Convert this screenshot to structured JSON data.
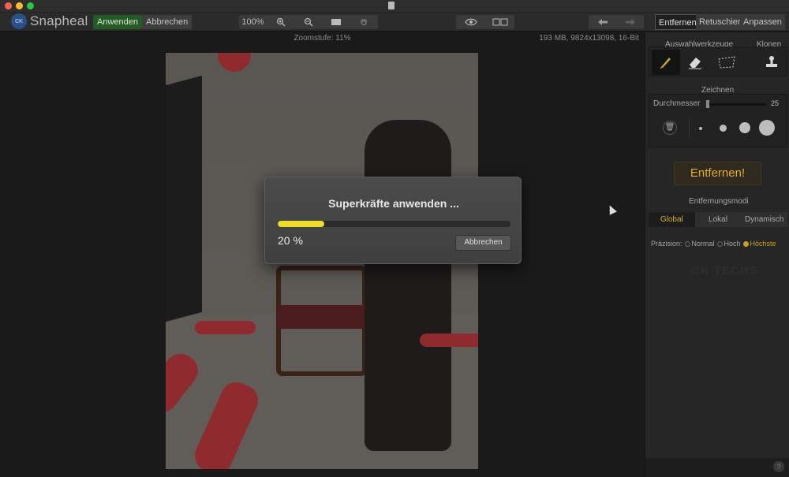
{
  "window": {
    "app_name": "Snapheal",
    "logo_badge": "CK"
  },
  "toolbar": {
    "apply_label": "Anwenden",
    "cancel_label": "Abbrechen",
    "zoom_percent": "100%",
    "zoom_in_icon": "zoom-in-icon",
    "zoom_out_icon": "zoom-out-icon",
    "fit_icon": "fit-screen-icon",
    "hand_icon": "hand-icon",
    "preview_icon": "eye-icon",
    "compare_icon": "split-view-icon",
    "undo_icon": "undo-arrow-icon",
    "redo_icon": "redo-arrow-icon",
    "tabs": [
      {
        "label": "Entfernen",
        "active": true
      },
      {
        "label": "Retuschieren",
        "active": false
      },
      {
        "label": "Anpassen",
        "active": false
      }
    ]
  },
  "canvas": {
    "zoom_label": "Zoomstufe: 11%",
    "file_info": "193 MB, 9824x13098, 16-Bit"
  },
  "dialog": {
    "title": "Superkräfte anwenden ...",
    "progress_text": "20 %",
    "progress_fraction": 0.2,
    "cancel_label": "Abbrechen"
  },
  "panel": {
    "selection_tools_label": "Auswahlwerkzeuge",
    "clone_label": "Klonen",
    "draw_label": "Zeichnen",
    "diameter_label": "Durchmesser",
    "diameter_value": "25",
    "remove_button": "Entfernen!",
    "removal_modes_label": "Entfernungsmodi",
    "modes": [
      {
        "label": "Global",
        "active": true
      },
      {
        "label": "Lokal",
        "active": false
      },
      {
        "label": "Dynamisch",
        "active": false
      }
    ],
    "precision_label": "Präzision:",
    "precision_options": [
      {
        "label": "Normal",
        "selected": false
      },
      {
        "label": "Hoch",
        "selected": false
      },
      {
        "label": "Höchste",
        "selected": true
      }
    ],
    "faded_logo": "CK TECHS",
    "help": "?"
  },
  "colors": {
    "accent": "#c9a227",
    "apply_green": "#245a26",
    "progress_yellow": "#f0dc2a",
    "mask_red": "#8f2a2e"
  }
}
